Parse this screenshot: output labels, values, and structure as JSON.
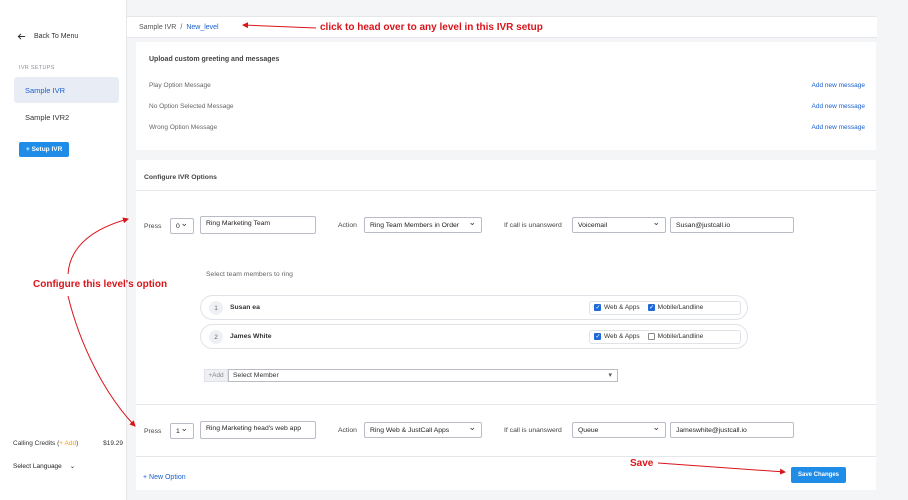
{
  "sidebar": {
    "back_label": "Back To Menu",
    "section_label": "IVR SETUPS",
    "items": [
      {
        "label": "Sample IVR",
        "active": true
      },
      {
        "label": "Sample IVR2",
        "active": false
      }
    ],
    "setup_button": "+ Setup IVR",
    "credits_label": "Calling Credits (",
    "credits_add": "+ Add",
    "credits_close": ")",
    "credits_amount": "$19.29",
    "language_label": "Select Language"
  },
  "breadcrumb": {
    "root": "Sample IVR",
    "separator": "/",
    "current": "New_level"
  },
  "greeting": {
    "title": "Upload custom greeting and messages",
    "rows": [
      {
        "label": "Play Option Message",
        "action": "Add new message"
      },
      {
        "label": "No Option Selected Message",
        "action": "Add new message"
      },
      {
        "label": "Wrong Option Message",
        "action": "Add new message"
      }
    ]
  },
  "options": {
    "title": "Configure IVR Options",
    "press_label": "Press",
    "action_label": "Action",
    "unanswered_label": "If call is unanswerd",
    "rows": [
      {
        "key": "0",
        "name": "Ring Marketing Team",
        "action": "Ring Team Members in Order",
        "fallback": "Voicemail",
        "target": "Susan@justcall.io"
      },
      {
        "key": "1",
        "name": "Ring Marketing head's web app",
        "action": "Ring Web & JustCall Apps",
        "fallback": "Queue",
        "target": "Jameswhite@justcall.io"
      }
    ],
    "ring_title": "Select team members to ring",
    "members": [
      {
        "num": "1",
        "name": "Susan ea",
        "web": "Web & Apps",
        "web_checked": true,
        "mobile": "Mobile/Landline",
        "mobile_checked": true
      },
      {
        "num": "2",
        "name": "James White",
        "web": "Web & Apps",
        "web_checked": true,
        "mobile": "Mobile/Landline",
        "mobile_checked": false
      }
    ],
    "add_label": "+Add",
    "select_member": "Select Member",
    "new_option": "+ New Option",
    "save_button": "Save Changes"
  },
  "annotations": {
    "top": "click to head over to any level in this IVR setup",
    "left": "Configure this level's option",
    "save": "Save"
  },
  "colors": {
    "accent": "#1f8ce8",
    "link": "#1a5fcf",
    "annotation": "#d9141a"
  }
}
